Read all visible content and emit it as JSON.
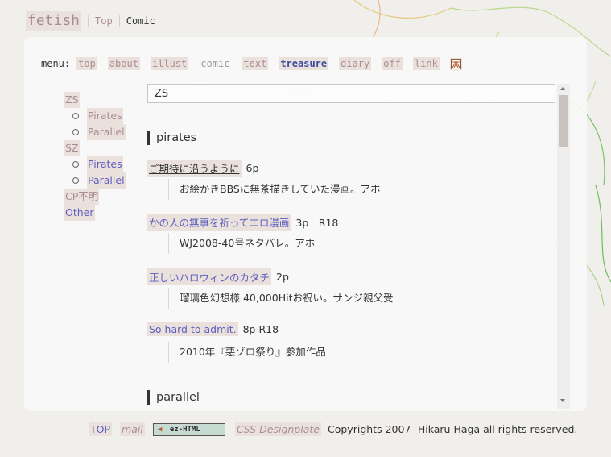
{
  "header": {
    "site_title": "fetish",
    "top_link": "Top",
    "current": "Comic"
  },
  "menu": {
    "label": "menu:",
    "items": [
      {
        "label": "top"
      },
      {
        "label": "about"
      },
      {
        "label": "illust"
      },
      {
        "label": "comic"
      },
      {
        "label": "text"
      },
      {
        "label": "treasure"
      },
      {
        "label": "diary"
      },
      {
        "label": "off"
      },
      {
        "label": "link"
      }
    ]
  },
  "sidebar": {
    "zs": "ZS",
    "zs_pirates": "Pirates",
    "zs_parallel": "Parallel",
    "sz": "SZ",
    "sz_pirates": "Pirates",
    "sz_parallel": "Parallel",
    "cp_unknown": "CP不明",
    "other": "Other"
  },
  "content": {
    "selected": "ZS",
    "section1": "pirates",
    "entries": [
      {
        "title": "ご期待に沿うように",
        "meta": "6p",
        "desc": "お絵かきBBSに無茶描きしていた漫画。アホ"
      },
      {
        "title": "かの人の無事を祈ってエロ漫画",
        "meta": "3p　R18",
        "desc": "WJ2008-40号ネタバレ。アホ"
      },
      {
        "title": "正しいハロウィンのカタチ",
        "meta": "2p",
        "desc": "瑠璃色幻想様 40,000Hitお祝い。サンジ親父受"
      },
      {
        "title": "So hard to admit.",
        "meta": "8p R18",
        "desc": "2010年『悪ゾロ祭り』参加作品"
      }
    ],
    "section2": "parallel"
  },
  "footer": {
    "top": "TOP",
    "mail": "mail",
    "badge": "ez-HTML",
    "css": "CSS Designplate",
    "copyright": "Copyrights 2007- Hikaru Haga all rights reserved."
  },
  "colors": {
    "link_blue": "#5c5ec0",
    "link_pink": "#a98d94",
    "highlight": "#ebe1dc"
  },
  "icons": [
    "link-banner-icon",
    "scroll-up-icon",
    "scroll-down-icon",
    "ez-html-badge-icon"
  ]
}
